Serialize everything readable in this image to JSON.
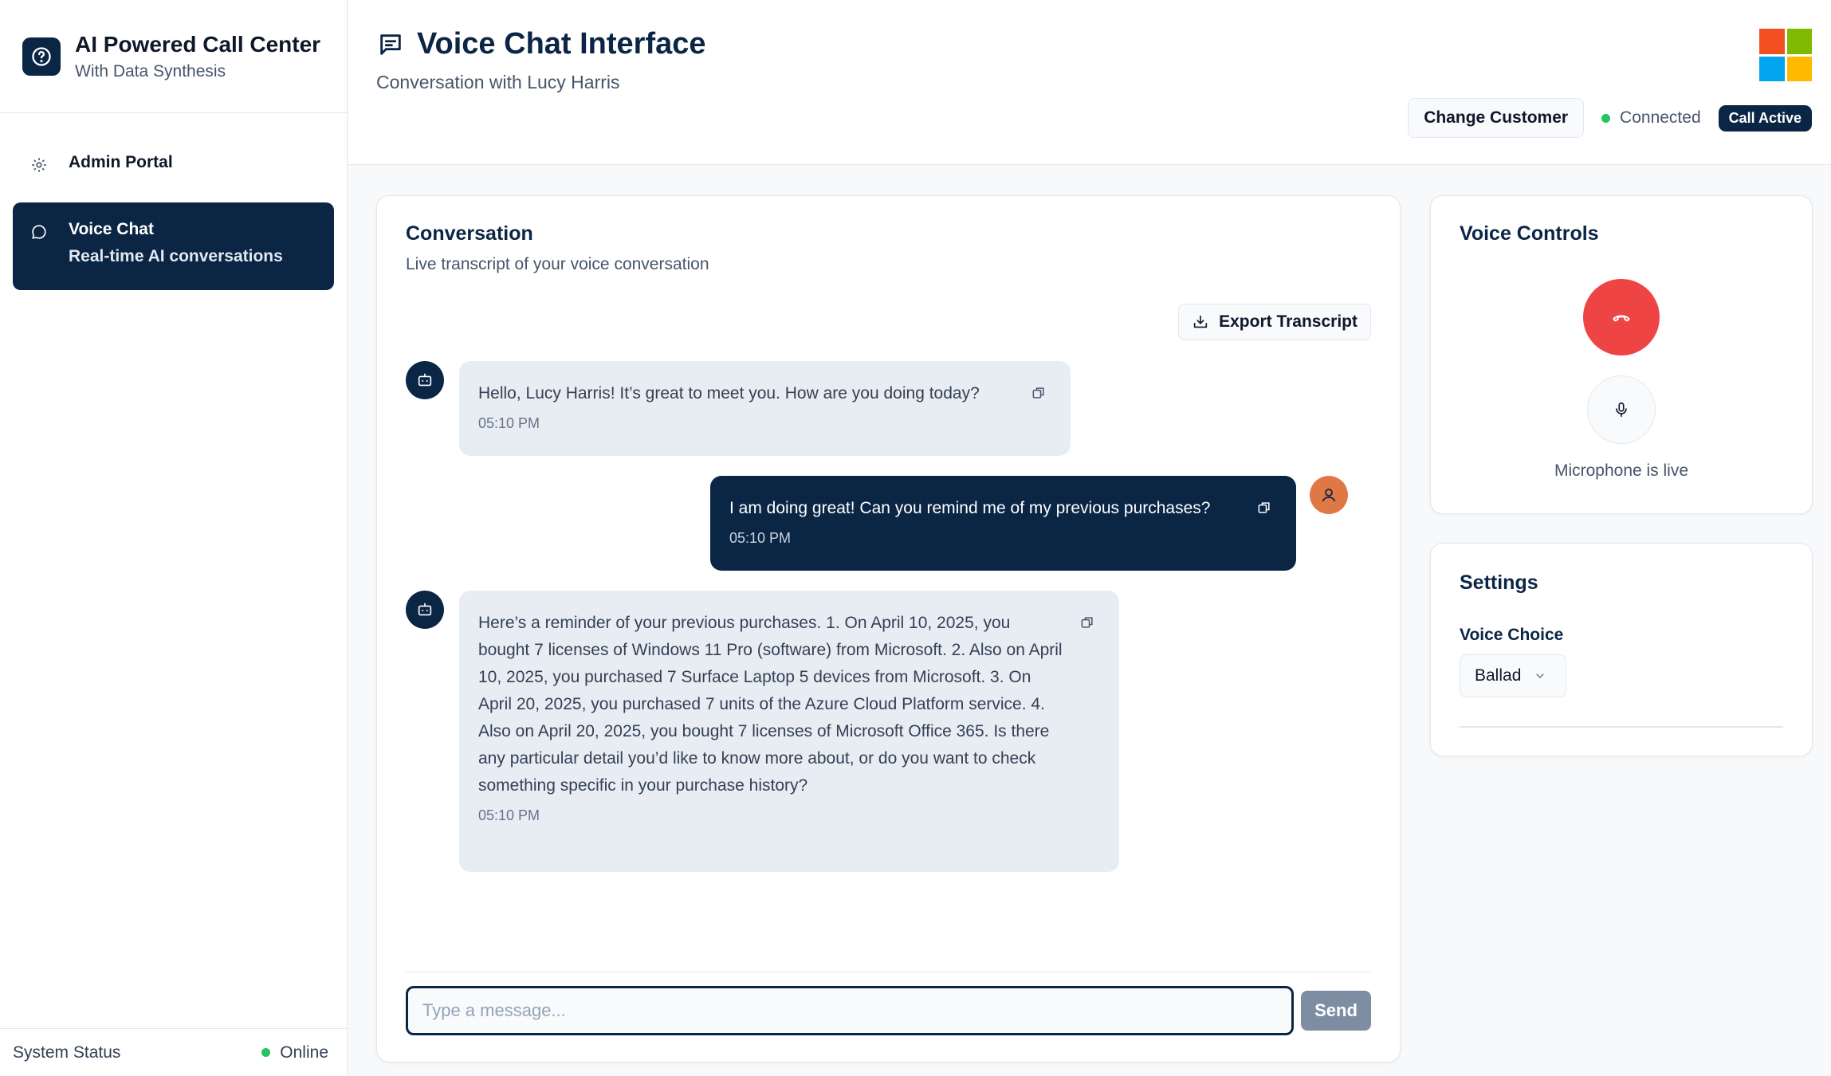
{
  "app": {
    "title": "AI Powered Call Center",
    "subtitle": "With Data Synthesis"
  },
  "sidebar": {
    "items": [
      {
        "label": "Admin Portal",
        "icon": "gear-icon"
      },
      {
        "label": "Voice Chat",
        "sub": "Real-time AI conversations",
        "icon": "chat-bubble-icon",
        "active": true
      }
    ],
    "status_label": "System Status",
    "status_value": "Online"
  },
  "header": {
    "title": "Voice Chat Interface",
    "subtitle": "Conversation with Lucy Harris",
    "change_customer": "Change Customer",
    "connection": "Connected",
    "call_badge": "Call Active"
  },
  "conversation": {
    "title": "Conversation",
    "subtitle": "Live transcript of your voice conversation",
    "export_label": "Export Transcript",
    "messages": [
      {
        "role": "bot",
        "text": "Hello, Lucy Harris! It’s great to meet you. How are you doing today?",
        "time": "05:10 PM"
      },
      {
        "role": "user",
        "text": "I am doing great! Can you remind me of my previous purchases?",
        "time": "05:10 PM"
      },
      {
        "role": "bot",
        "text": "Here’s a reminder of your previous purchases. 1. On April 10, 2025, you bought 7 licenses of Windows 11 Pro (software) from Microsoft. 2. Also on April 10, 2025, you purchased 7 Surface Laptop 5 devices from Microsoft. 3. On April 20, 2025, you purchased 7 units of the Azure Cloud Platform service. 4. Also on April 20, 2025, you bought 7 licenses of Microsoft Office 365. Is there any particular detail you’d like to know more about, or do you want to check something specific in your purchase history?",
        "time": "05:10 PM"
      }
    ],
    "input_placeholder": "Type a message...",
    "input_value": "",
    "send_label": "Send"
  },
  "voice_controls": {
    "title": "Voice Controls",
    "mic_status": "Microphone is live"
  },
  "settings": {
    "title": "Settings",
    "voice_choice_label": "Voice Choice",
    "voice_choice_value": "Ballad"
  },
  "colors": {
    "navy": "#0b2545",
    "hangup": "#ef4444",
    "online": "#22c55e",
    "user_avatar": "#e07845"
  }
}
